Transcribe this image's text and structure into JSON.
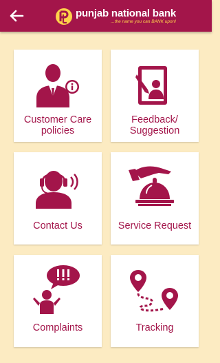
{
  "header": {
    "brand_name": "punjab national bank",
    "brand_tagline": "...the name you can BANK upon!",
    "back_icon": "back-arrow-icon"
  },
  "colors": {
    "primary": "#a3154a",
    "background": "#fcebc2",
    "tile": "#ffffff",
    "tagline": "#ffd24a"
  },
  "tiles": [
    {
      "line1": "Customer Care",
      "line2": "policies",
      "icon": "customer-care-icon"
    },
    {
      "line1": "Feedback/",
      "line2": "Suggestion",
      "icon": "feedback-icon"
    },
    {
      "line1": "Contact Us",
      "icon": "headset-icon"
    },
    {
      "line1": "Service Request",
      "icon": "service-bell-icon"
    },
    {
      "line1": "Complaints",
      "icon": "complaints-icon"
    },
    {
      "line1": "Tracking",
      "icon": "tracking-route-icon"
    }
  ]
}
